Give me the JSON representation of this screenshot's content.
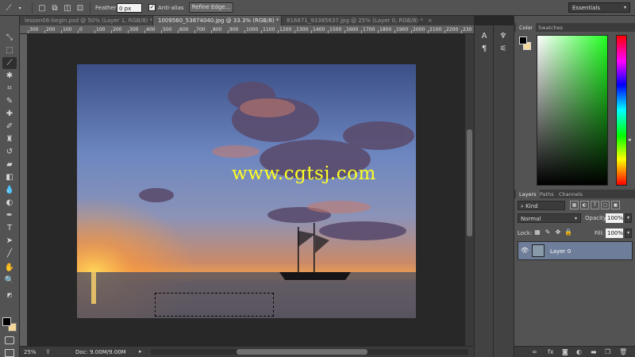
{
  "options_bar": {
    "feather_label": "Feather:",
    "feather_value": "0 px",
    "antialias_label": "Anti-alias",
    "antialias_checked": "✓",
    "refine_edge_label": "Refine Edge...",
    "workspace": "Essentials"
  },
  "tabs": [
    {
      "label": "lesson06-begin.psd @ 50% (Layer 1, RGB/8) *",
      "close": "×"
    },
    {
      "label": "1009560_53874040.jpg @ 33.3% (RGB/8) *",
      "close": "×"
    },
    {
      "label": "816671_93385637.jpg @ 25% (Layer 0, RGB/8) *",
      "close": "×"
    }
  ],
  "ruler_ticks": [
    "300",
    "200",
    "100",
    "0",
    "100",
    "200",
    "300",
    "400",
    "500",
    "600",
    "700",
    "800",
    "900",
    "1000",
    "1100",
    "1200",
    "1300",
    "1400",
    "1500",
    "1600",
    "1700",
    "1800",
    "1900",
    "2000",
    "2100",
    "2200",
    "230"
  ],
  "canvas": {
    "watermark": "www.cgtsj.com"
  },
  "status": {
    "zoom": "25%",
    "doc_info": "Doc: 9.00M/9.00M"
  },
  "color_panel": {
    "tabs": [
      "Color",
      "Swatches"
    ],
    "bg_color": "#f4d79a",
    "fg_color": "#000000"
  },
  "layers_panel": {
    "tabs": [
      "Layers",
      "Paths",
      "Channels"
    ],
    "kind": "Kind",
    "blend_mode": "Normal",
    "opacity_label": "Opacity:",
    "opacity_value": "100%",
    "lock_label": "Lock:",
    "fill_label": "Fill:",
    "fill_value": "100%",
    "layer_name": "Layer 0"
  },
  "colors": {
    "selected_layer": "#6e7d99",
    "watermark": "#ffff22"
  }
}
